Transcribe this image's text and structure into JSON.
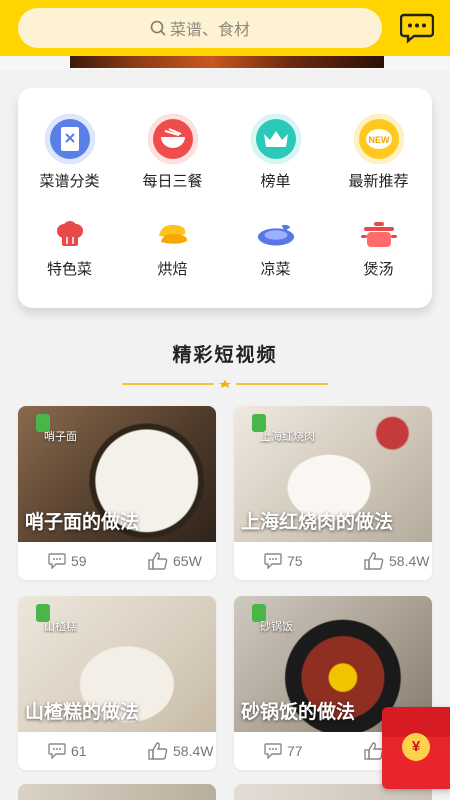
{
  "search": {
    "placeholder": "菜谱、食材"
  },
  "header": {
    "message_icon": "chat-bubble-icon"
  },
  "categories": [
    {
      "label": "菜谱分类",
      "icon": "recipe-book-icon"
    },
    {
      "label": "每日三餐",
      "icon": "bowl-icon"
    },
    {
      "label": "榜单",
      "icon": "crown-icon"
    },
    {
      "label": "最新推荐",
      "icon": "new-badge-icon"
    },
    {
      "label": "特色菜",
      "icon": "chef-hat-icon"
    },
    {
      "label": "烘焙",
      "icon": "bread-icon"
    },
    {
      "label": "凉菜",
      "icon": "dish-icon"
    },
    {
      "label": "煲汤",
      "icon": "soup-pot-icon"
    }
  ],
  "section": {
    "title": "精彩短视频"
  },
  "videos": [
    {
      "title": "哨子面的做法",
      "tag": "哨子面",
      "comments": "59",
      "likes": "65W"
    },
    {
      "title": "上海红烧肉的做法",
      "tag": "上海红烧肉",
      "comments": "75",
      "likes": "58.4W"
    },
    {
      "title": "山楂糕的做法",
      "tag": "山楂糕",
      "comments": "61",
      "likes": "58.4W"
    },
    {
      "title": "砂锅饭的做法",
      "tag": "砂锅饭",
      "comments": "77",
      "likes": ""
    }
  ],
  "redpacket": {
    "symbol": "¥"
  },
  "colors": {
    "header": "#ffd400",
    "accent": "#e8242c"
  }
}
